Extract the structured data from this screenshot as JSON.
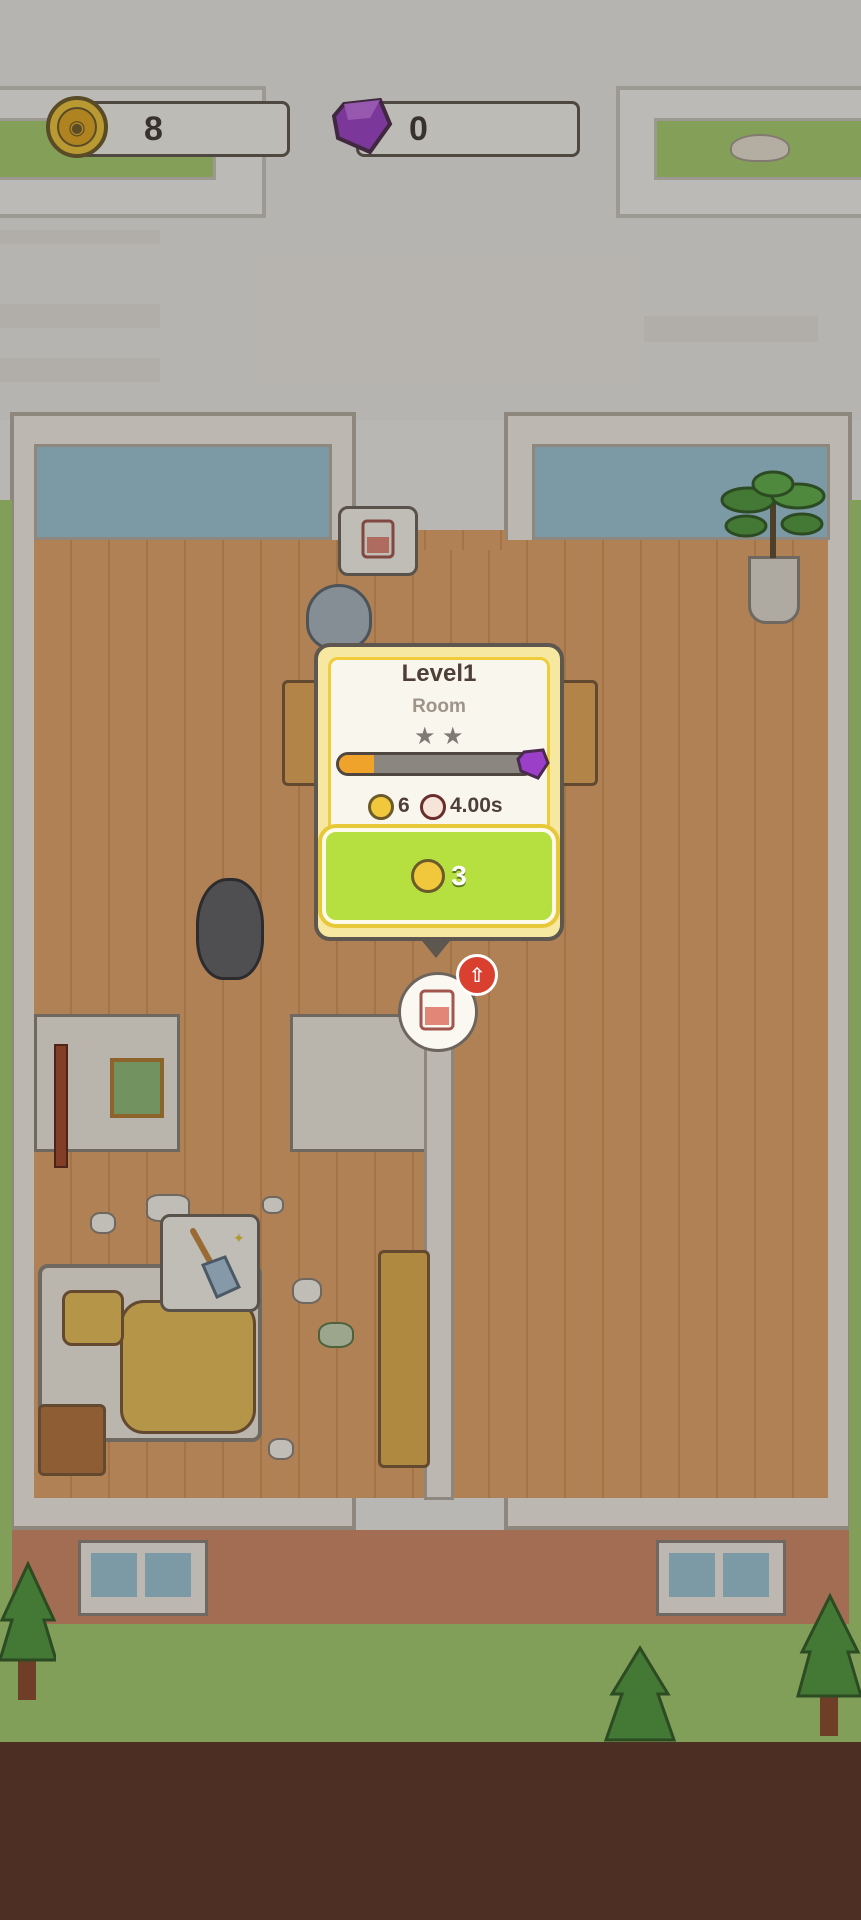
{
  "hud": {
    "coins": "8",
    "gems": "0"
  },
  "popup": {
    "title": "Level1",
    "subtitle": "Room",
    "stars_total": 2,
    "progress_fraction": 0.18,
    "income": "6",
    "time": "4.00s",
    "buy_cost": "3"
  },
  "icons": {
    "coin": "cat-coin-icon",
    "gem": "purple-gem-icon",
    "timer": "clock-icon",
    "bed": "bed-icon",
    "broom": "broom-icon",
    "upgrade": "arrow-up-icon"
  },
  "colors": {
    "buy_button": "#b6e040",
    "progress": "#f0a32b",
    "gem": "#9b3fc9",
    "coin": "#f1c73b"
  }
}
